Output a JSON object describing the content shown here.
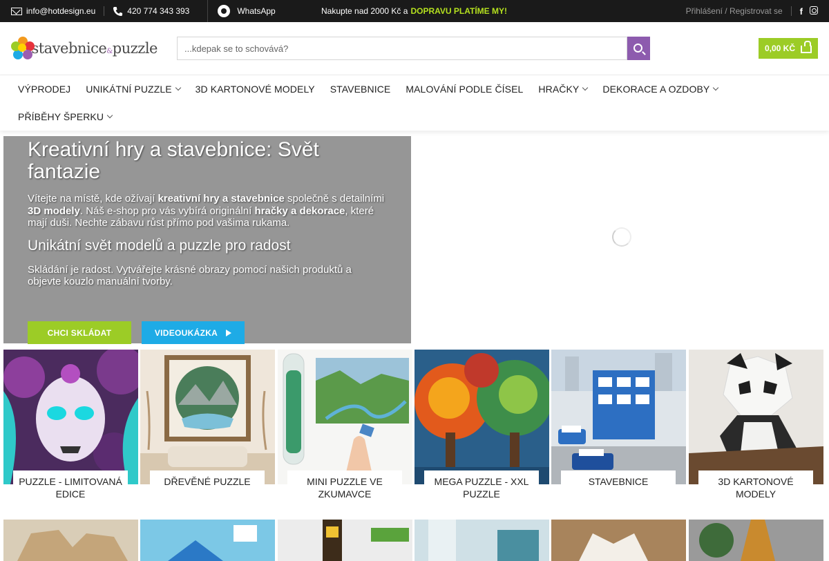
{
  "topbar": {
    "email": "info@hotdesign.eu",
    "phone": "420 774 343 393",
    "whatsapp": "WhatsApp",
    "promo_text": "Nakupte nad 2000 Kč a",
    "promo_highlight": "DOPRAVU PLATÍME MY!",
    "login": "Přihlášení / Registrovat se",
    "facebook": "f"
  },
  "header": {
    "logo_text_1": "stavebnice",
    "logo_text_amp": "&",
    "logo_text_2": "puzzle",
    "search_placeholder": "...kdepak se to schovává?",
    "cart_total": "0,00 KČ"
  },
  "nav": {
    "items": [
      "VÝPRODEJ",
      "UNIKÁTNÍ PUZZLE",
      "3D KARTONOVÉ MODELY",
      "STAVEBNICE",
      "MALOVÁNÍ PODLE ČÍSEL",
      "HRAČKY",
      "DEKORACE A OZDOBY",
      "PŘÍBĚHY ŠPERKU"
    ]
  },
  "hero": {
    "title": "Kreativní hry a stavebnice: Svět fantazie",
    "p1_a": "Vítejte na místě, kde ožívají ",
    "p1_b": "kreativní hry a stavebnice",
    "p1_c": " společně s detailními ",
    "p1_d": "3D modely",
    "p1_e": ". Náš e-shop pro vás vybírá originální ",
    "p1_f": "hračky a dekorace",
    "p1_g": ", které mají duši. Nechte zábavu růst přímo pod vašima rukama.",
    "subtitle": "Unikátní svět modelů a puzzle pro radost",
    "p2": "Skládání je radost. Vytvářejte krásné obrazy pomocí našich produktů a objevte kouzlo manuální tvorby.",
    "btn_primary": "CHCI SKLÁDAT",
    "btn_video": "VIDEOUKÁZKA"
  },
  "categories": [
    {
      "label": "Puzzle - limitovaná edice"
    },
    {
      "label": "Dřevěné puzzle"
    },
    {
      "label": "Mini puzzle ve zkumavce"
    },
    {
      "label": "Mega puzzle - XXL puzzle"
    },
    {
      "label": "Stavebnice"
    },
    {
      "label": "3D kartonové modely"
    }
  ],
  "colors": {
    "topbar_bg": "#1a1a1a",
    "accent_green": "#9ccc26",
    "accent_purple": "#8d5bae",
    "accent_blue": "#1eabe6",
    "hero_bg": "#969696"
  }
}
